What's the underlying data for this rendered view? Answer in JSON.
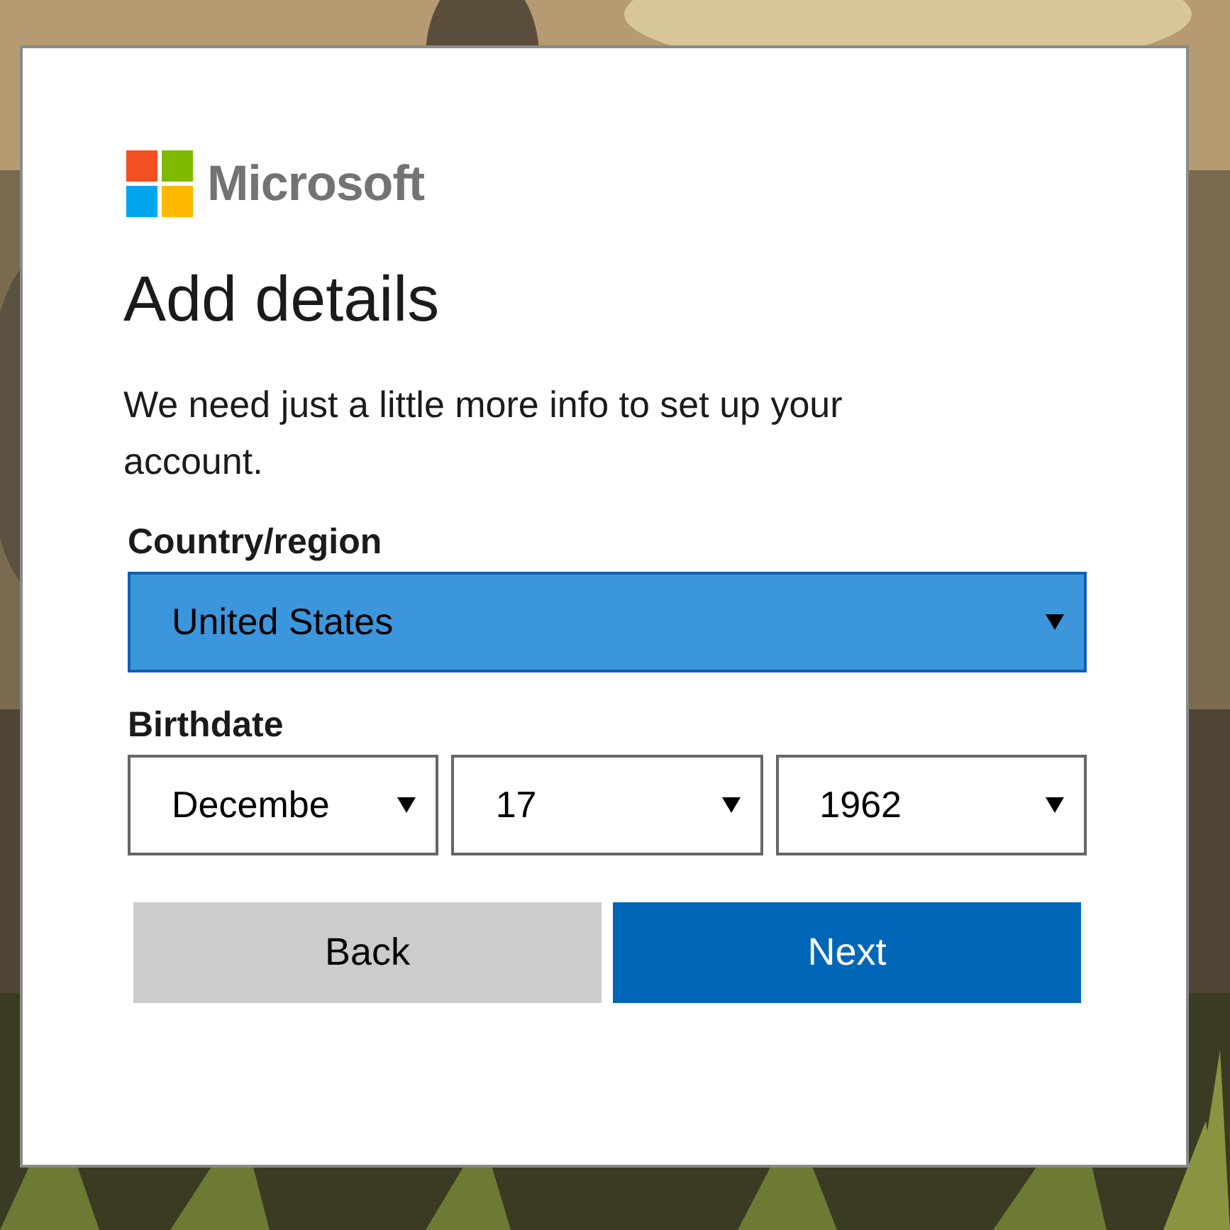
{
  "brand": "Microsoft",
  "title": "Add details",
  "description": "We need just a little more info to set up your account.",
  "country": {
    "label": "Country/region",
    "value": "United States",
    "highlighted": true
  },
  "birthdate": {
    "label": "Birthdate",
    "fields": [
      {
        "value": "Decembe",
        "highlighted": false
      },
      {
        "value": "17",
        "highlighted": false
      },
      {
        "value": "1962",
        "highlighted": false
      }
    ]
  },
  "buttons": [
    {
      "kind": "secondary",
      "label": "Back"
    },
    {
      "kind": "primary",
      "label": "Next"
    }
  ]
}
